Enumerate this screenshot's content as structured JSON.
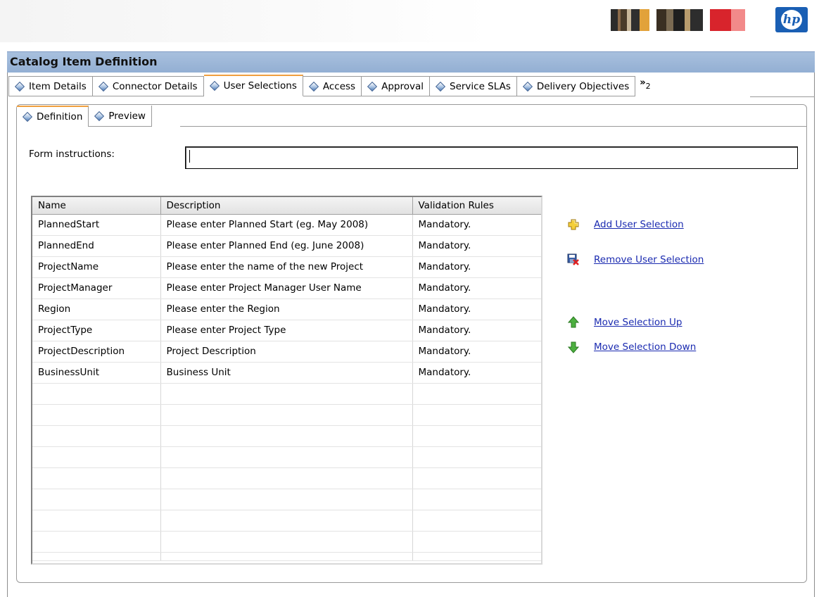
{
  "header": {
    "brand_logo": "hp-logo",
    "brand_text": "hp"
  },
  "title_bar": {
    "title": "Catalog Item Definition"
  },
  "main_tabs": [
    {
      "label": "Item Details",
      "icon": "diamond-icon",
      "active": false
    },
    {
      "label": "Connector Details",
      "icon": "diamond-icon",
      "active": false
    },
    {
      "label": "User Selections",
      "icon": "diamond-icon",
      "active": true
    },
    {
      "label": "Access",
      "icon": "diamond-icon",
      "active": false
    },
    {
      "label": "Approval",
      "icon": "diamond-icon",
      "active": false
    },
    {
      "label": "Service SLAs",
      "icon": "diamond-icon",
      "active": false
    },
    {
      "label": "Delivery Objectives",
      "icon": "diamond-icon",
      "active": false
    }
  ],
  "overflow_tabs": {
    "symbol": "»",
    "count": "2"
  },
  "sub_tabs": [
    {
      "label": "Definition",
      "icon": "diamond-icon",
      "active": true
    },
    {
      "label": "Preview",
      "icon": "diamond-icon",
      "active": false
    }
  ],
  "form": {
    "instructions_label": "Form instructions:",
    "instructions_value": ""
  },
  "table": {
    "columns": [
      "Name",
      "Description",
      "Validation Rules"
    ],
    "rows": [
      [
        "PlannedStart",
        "Please enter Planned Start (eg. May 2008)",
        "Mandatory."
      ],
      [
        "PlannedEnd",
        "Please enter Planned End (eg. June 2008)",
        "Mandatory."
      ],
      [
        "ProjectName",
        "Please enter the name of the new Project",
        "Mandatory."
      ],
      [
        "ProjectManager",
        "Please enter Project Manager User Name",
        "Mandatory."
      ],
      [
        "Region",
        "Please enter the Region",
        "Mandatory."
      ],
      [
        "ProjectType",
        "Please enter Project Type",
        "Mandatory."
      ],
      [
        "ProjectDescription",
        "Project Description",
        "Mandatory."
      ],
      [
        "BusinessUnit",
        "Business Unit",
        "Mandatory."
      ]
    ]
  },
  "actions": {
    "add": {
      "label": "Add User Selection",
      "icon": "add-plus-icon"
    },
    "remove": {
      "label": "Remove User Selection",
      "icon": "remove-disk-icon"
    },
    "up": {
      "label": "Move Selection Up",
      "icon": "arrow-up-icon"
    },
    "down": {
      "label": "Move Selection Down",
      "icon": "arrow-down-icon"
    }
  },
  "colors": {
    "title_bar": "#9fb9dc",
    "active_tab_accent": "#f0a040",
    "link": "#1a2ab0",
    "hp_blue": "#1a5fb4"
  }
}
